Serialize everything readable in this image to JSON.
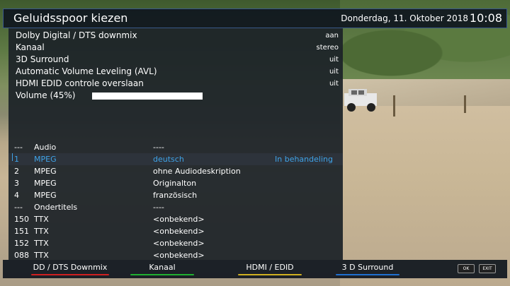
{
  "header": {
    "title": "Geluidsspoor kiezen",
    "date": "Donderdag, 11. Oktober 2018",
    "time": "10:08"
  },
  "settings": [
    {
      "label": "Dolby Digital / DTS downmix",
      "value": "aan"
    },
    {
      "label": "Kanaal",
      "value": "stereo"
    },
    {
      "label": "3D Surround",
      "value": "uit"
    },
    {
      "label": "Automatic Volume Leveling (AVL)",
      "value": "uit"
    },
    {
      "label": "HDMI EDID controle overslaan",
      "value": "uit"
    },
    {
      "label": "Volume (45%)",
      "value": ""
    }
  ],
  "volume": {
    "percent": 45
  },
  "tracks": [
    {
      "num": "---",
      "codec": "Audio",
      "lang": "----",
      "status": ""
    },
    {
      "num": "1",
      "codec": "MPEG",
      "lang": "deutsch",
      "status": "In behandeling"
    },
    {
      "num": "2",
      "codec": "MPEG",
      "lang": "ohne Audiodeskription",
      "status": ""
    },
    {
      "num": "3",
      "codec": "MPEG",
      "lang": "Originalton",
      "status": ""
    },
    {
      "num": "4",
      "codec": "MPEG",
      "lang": "französisch",
      "status": ""
    },
    {
      "num": "---",
      "codec": "Ondertitels",
      "lang": "----",
      "status": ""
    },
    {
      "num": "150",
      "codec": "TTX",
      "lang": "<onbekend>",
      "status": ""
    },
    {
      "num": "151",
      "codec": "TTX",
      "lang": "<onbekend>",
      "status": ""
    },
    {
      "num": "152",
      "codec": "TTX",
      "lang": "<onbekend>",
      "status": ""
    },
    {
      "num": "088",
      "codec": "TTX",
      "lang": "<onbekend>",
      "status": ""
    }
  ],
  "footer": {
    "red": "DD / DTS Downmix",
    "green": "Kanaal",
    "yellow": "HDMI / EDID",
    "blue": "3 D Surround",
    "ok": "OK",
    "exit": "EXIT"
  },
  "colors": {
    "accent": "#3fa3e8",
    "red": "#d02020",
    "green": "#20b030",
    "yellow": "#d0b020",
    "blue": "#2070d0"
  }
}
